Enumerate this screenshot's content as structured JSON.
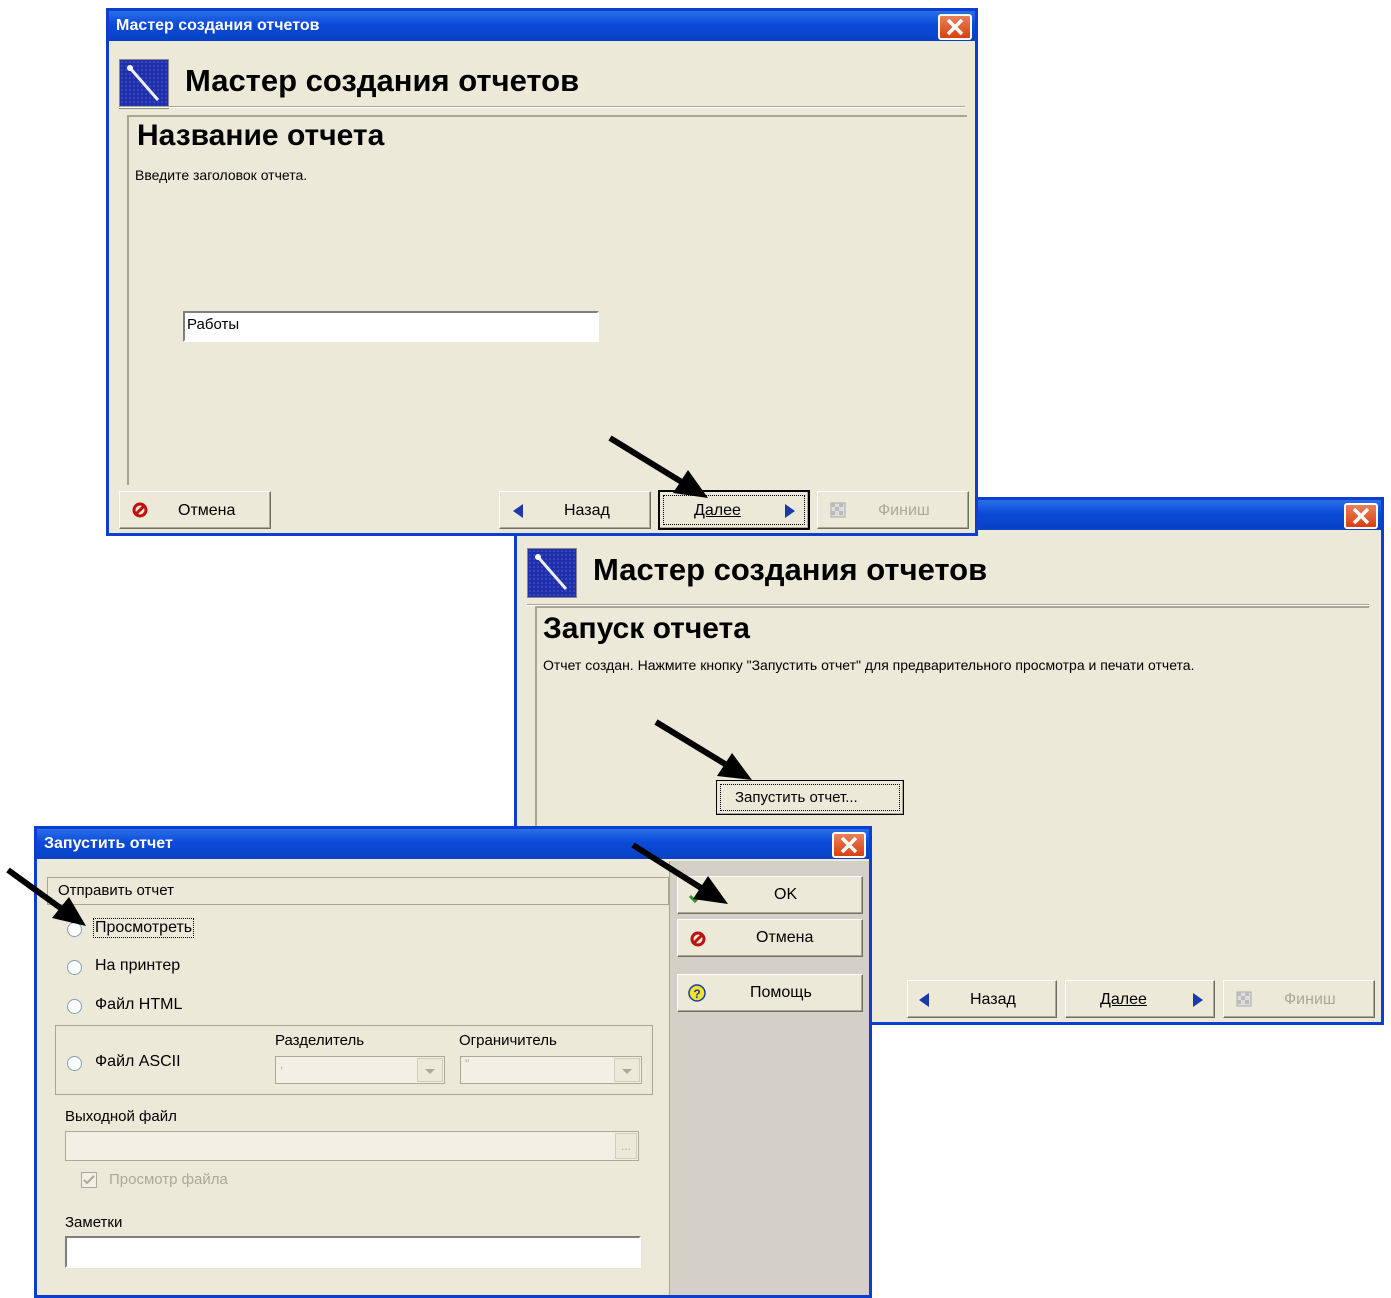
{
  "wizard1": {
    "window_title": "Мастер создания отчетов",
    "header": "Мастер создания отчетов",
    "step_title": "Название отчета",
    "description": "Введите заголовок отчета.",
    "report_name_value": "Работы",
    "buttons": {
      "cancel": "Отмена",
      "back": "Назад",
      "next": "Далее",
      "finish": "Финиш"
    }
  },
  "wizard2": {
    "header": "Мастер создания отчетов",
    "step_title": "Запуск отчета",
    "description": "Отчет создан. Нажмите кнопку \"Запустить отчет\" для предварительного просмотра и печати отчета.",
    "run_button": "Запустить отчет...",
    "buttons": {
      "back": "Назад",
      "next": "Далее",
      "finish": "Финиш"
    }
  },
  "run_dialog": {
    "window_title": "Запустить отчет",
    "group_label": "Отправить отчет",
    "options": {
      "preview": "Просмотреть",
      "printer": "На принтер",
      "html": "Файл HTML",
      "ascii": "Файл ASCII"
    },
    "separator_label": "Разделитель",
    "separator_value": ",",
    "delimiter_label": "Ограничитель",
    "delimiter_value": "\"",
    "output_file_label": "Выходной файл",
    "output_file_value": "",
    "browse_label": "...",
    "view_file_label": "Просмотр файла",
    "notes_label": "Заметки",
    "notes_value": "",
    "buttons": {
      "ok": "OK",
      "cancel": "Отмена",
      "help": "Помощь"
    }
  },
  "icons": [
    "wizard-icon",
    "close-icon",
    "cancel-icon",
    "back-arrow-icon",
    "next-arrow-icon",
    "finish-flag-icon",
    "ok-check-icon",
    "help-icon",
    "pointer-arrow"
  ],
  "colors": {
    "titlebar": "#0a4ad8",
    "window_bg": "#ece9d8",
    "close": "#d8400f"
  }
}
